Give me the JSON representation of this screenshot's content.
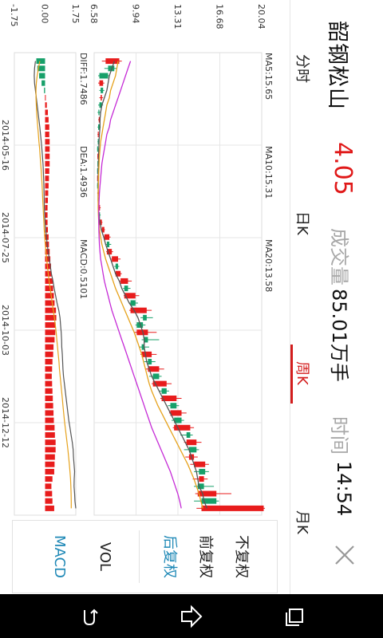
{
  "stock": {
    "name": "韶钢松山",
    "price": "4.05",
    "volume_label": "成交量",
    "volume_value": "85.01万手",
    "time_label": "时间",
    "time_value": "14:54"
  },
  "tabs": [
    {
      "label": "分时",
      "active": false
    },
    {
      "label": "日K",
      "active": false
    },
    {
      "label": "周K",
      "active": true
    },
    {
      "label": "月K",
      "active": false
    }
  ],
  "ma": {
    "ma5": "MA5:15.65",
    "ma10": "MA10:15.31",
    "ma20": "MA20:13.58",
    "ma5_color": "#555555",
    "ma10_color": "#e6a21c",
    "ma20_color": "#c52bd6"
  },
  "macd": {
    "diff": "DIFF:1.7486",
    "dea": "DEA:1.4936",
    "macd": "MACD:0.5101",
    "diff_color": "#555555",
    "dea_color": "#e6a21c",
    "macd_color": "#c52bd6"
  },
  "panel": {
    "options": [
      {
        "label": "不复权",
        "active": false
      },
      {
        "label": "前复权",
        "active": false
      },
      {
        "label": "后复权",
        "active": true
      },
      {
        "label": "VOL",
        "active": false
      },
      {
        "label": "MACD",
        "active": true
      }
    ]
  },
  "colors": {
    "up": "#e81c1c",
    "down": "#17a06a",
    "active_tab": "#d31d1d",
    "active_option": "#1e88b6"
  },
  "chart_data": {
    "type": "candlestick",
    "price_axis": {
      "ticks": [
        "20.04",
        "16.68",
        "13.31",
        "9.94",
        "6.58"
      ],
      "range": [
        6.58,
        20.04
      ]
    },
    "macd_axis": {
      "ticks": [
        "1.75",
        "0.00",
        "-1.75"
      ],
      "range": [
        -1.75,
        1.75
      ]
    },
    "dates": [
      "2014-05-16",
      "2014-07-25",
      "2014-10-03",
      "2014-12-12"
    ],
    "candles": [
      [
        7.5,
        8.6,
        7.2,
        8.8
      ],
      [
        8.2,
        7.7,
        7.4,
        8.4
      ],
      [
        7.7,
        7.0,
        6.9,
        7.8
      ],
      [
        7.0,
        7.3,
        6.9,
        7.4
      ],
      [
        7.3,
        7.1,
        7.0,
        7.4
      ],
      [
        7.1,
        7.2,
        7.0,
        7.3
      ],
      [
        7.2,
        7.0,
        6.9,
        7.3
      ],
      [
        7.0,
        6.95,
        6.85,
        7.1
      ],
      [
        6.95,
        7.05,
        6.9,
        7.1
      ],
      [
        7.05,
        6.9,
        6.85,
        7.1
      ],
      [
        6.9,
        6.95,
        6.85,
        7.0
      ],
      [
        6.95,
        6.9,
        6.85,
        7.0
      ],
      [
        6.9,
        6.88,
        6.82,
        6.95
      ],
      [
        6.88,
        6.92,
        6.84,
        6.96
      ],
      [
        6.92,
        6.9,
        6.86,
        6.97
      ],
      [
        6.9,
        6.88,
        6.83,
        6.93
      ],
      [
        6.88,
        6.9,
        6.84,
        6.94
      ],
      [
        6.9,
        6.87,
        6.82,
        6.93
      ],
      [
        6.87,
        6.95,
        6.83,
        7.0
      ],
      [
        6.95,
        6.92,
        6.88,
        7.0
      ],
      [
        6.92,
        7.05,
        6.9,
        7.1
      ],
      [
        7.05,
        7.0,
        6.95,
        7.1
      ],
      [
        7.0,
        7.2,
        6.98,
        7.25
      ],
      [
        7.2,
        7.4,
        7.15,
        7.45
      ],
      [
        7.4,
        7.8,
        7.35,
        7.9
      ],
      [
        7.8,
        7.6,
        7.5,
        7.95
      ],
      [
        7.6,
        8.0,
        7.55,
        8.1
      ],
      [
        8.0,
        8.5,
        7.95,
        8.7
      ],
      [
        8.5,
        8.3,
        8.2,
        8.6
      ],
      [
        8.3,
        8.7,
        8.25,
        8.8
      ],
      [
        8.7,
        9.3,
        8.6,
        9.6
      ],
      [
        9.3,
        9.0,
        8.9,
        9.5
      ],
      [
        9.0,
        9.9,
        8.95,
        10.2
      ],
      [
        9.9,
        9.5,
        9.4,
        10.1
      ],
      [
        9.5,
        10.8,
        9.4,
        11.2
      ],
      [
        10.8,
        10.5,
        10.3,
        11.3
      ],
      [
        10.5,
        10.0,
        9.9,
        10.7
      ],
      [
        10.0,
        10.9,
        9.8,
        11.6
      ],
      [
        10.9,
        10.6,
        10.4,
        11.8
      ],
      [
        10.6,
        10.4,
        10.2,
        11.0
      ],
      [
        10.4,
        11.2,
        10.3,
        11.6
      ],
      [
        11.2,
        10.9,
        10.6,
        11.5
      ],
      [
        10.9,
        11.8,
        10.7,
        12.2
      ],
      [
        11.8,
        11.3,
        11.0,
        12.0
      ],
      [
        11.3,
        12.4,
        11.2,
        12.8
      ],
      [
        12.4,
        12.0,
        11.8,
        12.6
      ],
      [
        12.0,
        13.2,
        11.9,
        13.6
      ],
      [
        13.2,
        12.7,
        12.5,
        13.4
      ],
      [
        12.7,
        13.6,
        12.6,
        14.0
      ],
      [
        13.6,
        13.0,
        12.8,
        13.8
      ],
      [
        13.0,
        14.3,
        12.9,
        14.6
      ],
      [
        14.3,
        14.0,
        13.5,
        14.5
      ],
      [
        14.0,
        14.8,
        13.8,
        15.2
      ],
      [
        14.8,
        14.2,
        13.8,
        15.0
      ],
      [
        14.2,
        14.6,
        13.9,
        14.9
      ],
      [
        14.6,
        15.5,
        14.3,
        15.8
      ],
      [
        15.5,
        15.0,
        14.6,
        15.8
      ],
      [
        15.0,
        15.4,
        14.5,
        15.7
      ],
      [
        15.4,
        14.9,
        14.6,
        16.2
      ],
      [
        14.9,
        16.4,
        14.7,
        17.6
      ],
      [
        16.4,
        15.2,
        14.6,
        16.6
      ],
      [
        15.2,
        20.2,
        14.8,
        20.3
      ]
    ],
    "ma5": [
      8.2,
      8.0,
      7.8,
      7.7,
      7.6,
      7.4,
      7.2,
      7.1,
      7.05,
      7.05,
      7.0,
      6.97,
      6.95,
      6.93,
      6.92,
      6.9,
      6.9,
      6.9,
      6.9,
      6.9,
      6.93,
      6.97,
      7.05,
      7.15,
      7.35,
      7.5,
      7.7,
      7.9,
      8.1,
      8.3,
      8.6,
      8.8,
      9.1,
      9.4,
      9.8,
      10.1,
      10.3,
      10.5,
      10.6,
      10.6,
      10.7,
      10.8,
      11.0,
      11.2,
      11.5,
      11.8,
      12.1,
      12.4,
      12.7,
      13.0,
      13.3,
      13.6,
      13.9,
      14.2,
      14.4,
      14.6,
      14.8,
      14.9,
      15.0,
      15.3,
      15.4,
      15.65
    ],
    "ma10": [
      8.5,
      8.4,
      8.3,
      8.1,
      7.9,
      7.8,
      7.6,
      7.5,
      7.4,
      7.3,
      7.2,
      7.1,
      7.05,
      7.0,
      6.98,
      6.95,
      6.93,
      6.92,
      6.9,
      6.9,
      6.9,
      6.92,
      6.95,
      7.0,
      7.1,
      7.2,
      7.35,
      7.5,
      7.7,
      7.9,
      8.1,
      8.3,
      8.55,
      8.8,
      9.05,
      9.3,
      9.55,
      9.8,
      10.0,
      10.2,
      10.4,
      10.55,
      10.7,
      10.85,
      11.0,
      11.2,
      11.45,
      11.7,
      12.0,
      12.3,
      12.6,
      12.9,
      13.2,
      13.5,
      13.8,
      14.1,
      14.35,
      14.6,
      14.8,
      15.0,
      15.15,
      15.31
    ],
    "ma20": [
      9.5,
      9.3,
      9.1,
      8.9,
      8.7,
      8.5,
      8.3,
      8.1,
      7.9,
      7.8,
      7.6,
      7.5,
      7.4,
      7.3,
      7.2,
      7.15,
      7.1,
      7.05,
      7.0,
      6.98,
      6.96,
      6.95,
      6.95,
      6.96,
      6.98,
      7.0,
      7.05,
      7.1,
      7.2,
      7.3,
      7.4,
      7.55,
      7.7,
      7.85,
      8.0,
      8.2,
      8.4,
      8.6,
      8.8,
      9.0,
      9.2,
      9.4,
      9.6,
      9.8,
      10.0,
      10.2,
      10.4,
      10.6,
      10.8,
      11.0,
      11.2,
      11.45,
      11.7,
      11.95,
      12.2,
      12.45,
      12.7,
      12.9,
      13.1,
      13.3,
      13.45,
      13.58
    ],
    "macd_diff": [
      -0.55,
      -0.6,
      -0.62,
      -0.6,
      -0.55,
      -0.5,
      -0.45,
      -0.4,
      -0.35,
      -0.3,
      -0.26,
      -0.22,
      -0.18,
      -0.15,
      -0.12,
      -0.1,
      -0.08,
      -0.07,
      -0.06,
      -0.05,
      -0.04,
      -0.02,
      0.0,
      0.03,
      0.08,
      0.12,
      0.18,
      0.24,
      0.3,
      0.36,
      0.45,
      0.52,
      0.6,
      0.68,
      0.78,
      0.85,
      0.88,
      0.92,
      0.94,
      0.95,
      0.98,
      1.0,
      1.02,
      1.05,
      1.1,
      1.15,
      1.2,
      1.25,
      1.3,
      1.35,
      1.42,
      1.48,
      1.55,
      1.6,
      1.62,
      1.65,
      1.68,
      1.66,
      1.65,
      1.68,
      1.7,
      1.75
    ],
    "macd_dea": [
      -0.3,
      -0.38,
      -0.45,
      -0.5,
      -0.52,
      -0.52,
      -0.5,
      -0.48,
      -0.45,
      -0.42,
      -0.38,
      -0.35,
      -0.31,
      -0.28,
      -0.25,
      -0.22,
      -0.19,
      -0.17,
      -0.15,
      -0.13,
      -0.11,
      -0.09,
      -0.07,
      -0.05,
      -0.02,
      0.01,
      0.05,
      0.09,
      0.13,
      0.18,
      0.23,
      0.29,
      0.35,
      0.41,
      0.47,
      0.53,
      0.58,
      0.63,
      0.67,
      0.71,
      0.75,
      0.79,
      0.82,
      0.86,
      0.9,
      0.94,
      0.98,
      1.02,
      1.06,
      1.1,
      1.15,
      1.2,
      1.25,
      1.3,
      1.34,
      1.38,
      1.42,
      1.45,
      1.47,
      1.48,
      1.49,
      1.49
    ]
  }
}
